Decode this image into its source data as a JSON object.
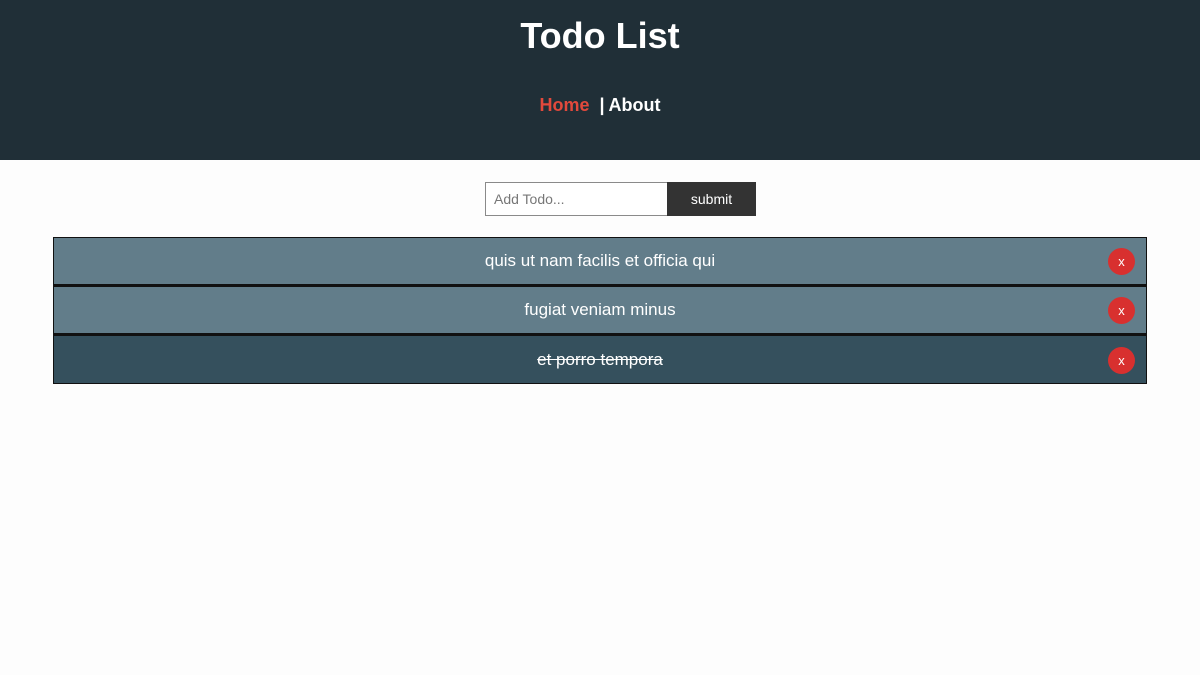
{
  "header": {
    "title": "Todo List",
    "nav": {
      "home_label": "Home",
      "separator": "|",
      "about_label": "About",
      "active": "Home"
    }
  },
  "form": {
    "input_value": "",
    "input_placeholder": "Add Todo...",
    "submit_label": "submit"
  },
  "todos": [
    {
      "title": "quis ut nam facilis et officia qui",
      "completed": false,
      "delete_label": "x"
    },
    {
      "title": "fugiat veniam minus",
      "completed": false,
      "delete_label": "x"
    },
    {
      "title": "et porro tempora",
      "completed": true,
      "delete_label": "x"
    }
  ],
  "colors": {
    "header_bg": "#202f37",
    "nav_active": "#e2493c",
    "item_bg": "#627d8a",
    "item_completed_bg": "#35505d",
    "delete_bg": "#d8302f",
    "submit_bg": "#333333"
  }
}
